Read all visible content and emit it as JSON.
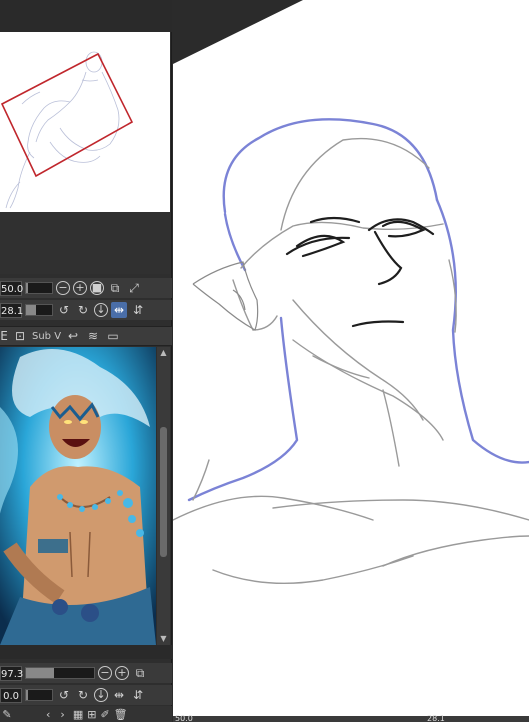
{
  "navigator": {
    "zoom_value": "50.0",
    "rotate_value": "28.1"
  },
  "sub_view": {
    "tab_label": "Sub V",
    "zoom_value": "97.3",
    "rotate_value": "0.0"
  },
  "canvas_status": {
    "zoom_value": "50.0",
    "rotate_value": "28.1"
  },
  "icons": {
    "zoom_out": "zoom-out-icon",
    "zoom_in": "zoom-in-icon",
    "fit": "fit-icon",
    "rotate_left": "rotate-left-icon",
    "rotate_right": "rotate-right-icon",
    "reset_rotate": "reset-rotation-icon",
    "flip_h": "flip-horizontal-icon",
    "flip_v": "flip-vertical-icon"
  },
  "colors": {
    "accent": "#4a6ea8",
    "navigator_frame": "#c0272d",
    "guide_stroke": "#7b83d6",
    "sketch_stroke": "#2a2a2a"
  }
}
